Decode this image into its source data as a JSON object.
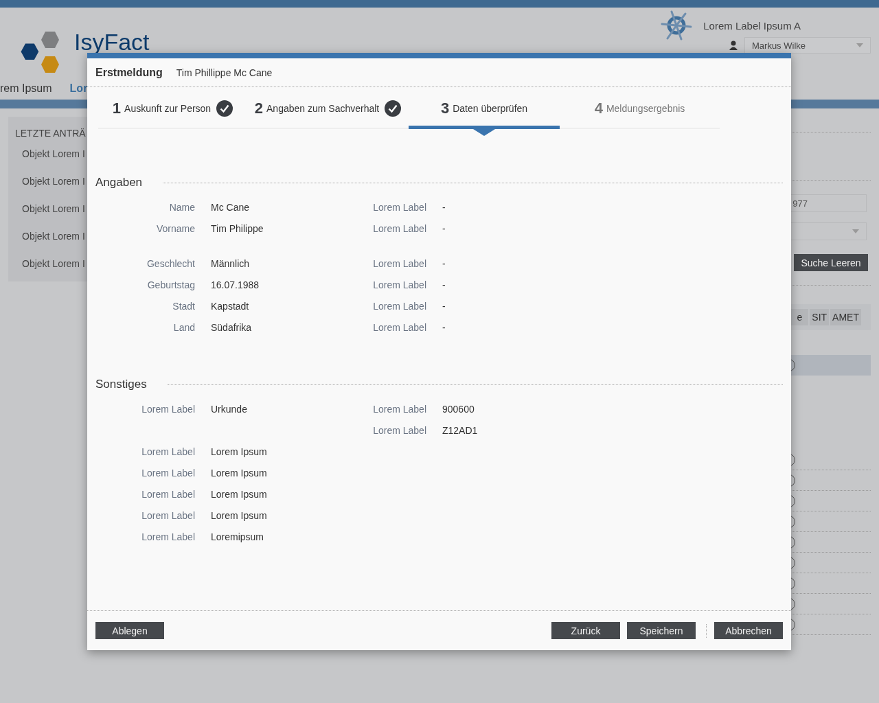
{
  "background": {
    "logo_text": "IsyFact",
    "app_label": "Lorem Label Ipsum A",
    "user": "Markus Wilke",
    "nav": [
      {
        "label": "rem Ipsum",
        "selected": false
      },
      {
        "label": "Lor",
        "selected": true
      }
    ],
    "sidebar": {
      "title": "LETZTE ANTRÄ",
      "items": [
        "Objekt Lorem I",
        "Objekt Lorem I",
        "Objekt Lorem I",
        "Objekt Lorem I",
        "Objekt Lorem I"
      ]
    },
    "search_field": {
      "value": "977"
    },
    "clear_button": "Suche Leeren",
    "table": {
      "columns": [
        "e",
        "SIT",
        "AMET"
      ],
      "rows": [
        {
          "selected": true
        },
        {
          "selected": false
        },
        {
          "selected": false
        },
        {
          "selected": false
        },
        {
          "selected": false
        },
        {
          "selected": false
        },
        {
          "selected": false
        },
        {
          "selected": false
        },
        {
          "selected": false
        },
        {
          "selected": false
        }
      ]
    }
  },
  "dialog": {
    "title": "Erstmeldung",
    "subtitle": "Tim Phillippe Mc Cane",
    "steps": [
      {
        "number": "1",
        "label": "Auskunft zur Person",
        "completed": true,
        "selected": false
      },
      {
        "number": "2",
        "label": "Angaben zum Sachverhalt",
        "completed": true,
        "selected": false
      },
      {
        "number": "3",
        "label": "Daten überprüfen",
        "completed": false,
        "selected": true
      },
      {
        "number": "4",
        "label": "Meldungsergebnis",
        "completed": false,
        "selected": false
      }
    ],
    "sections": [
      {
        "title": "Angaben",
        "groups": [
          [
            {
              "left": {
                "label": "Name",
                "value": "Mc Cane"
              },
              "right": {
                "label": "Lorem Label",
                "value": "-"
              }
            },
            {
              "left": {
                "label": "Vorname",
                "value": "Tim Philippe"
              },
              "right": {
                "label": "Lorem Label",
                "value": "-"
              }
            }
          ],
          [
            {
              "left": {
                "label": "Geschlecht",
                "value": "Männlich"
              },
              "right": {
                "label": "Lorem Label",
                "value": "-"
              }
            },
            {
              "left": {
                "label": "Geburtstag",
                "value": "16.07.1988"
              },
              "right": {
                "label": "Lorem Label",
                "value": "-"
              }
            },
            {
              "left": {
                "label": "Stadt",
                "value": "Kapstadt"
              },
              "right": {
                "label": "Lorem Label",
                "value": "-"
              }
            },
            {
              "left": {
                "label": "Land",
                "value": "Südafrika"
              },
              "right": {
                "label": "Lorem Label",
                "value": "-"
              }
            }
          ]
        ]
      },
      {
        "title": "Sonstiges",
        "groups": [
          [
            {
              "left": {
                "label": "Lorem Label",
                "value": "Urkunde"
              },
              "right": {
                "label": "Lorem Label",
                "value": "900600"
              }
            },
            {
              "right": {
                "label": "Lorem Label",
                "value": "Z12AD1"
              }
            },
            {
              "left": {
                "label": "Lorem Label",
                "value": "Lorem Ipsum"
              }
            },
            {
              "left": {
                "label": "Lorem Label",
                "value": "Lorem Ipsum"
              }
            },
            {
              "left": {
                "label": "Lorem Label",
                "value": "Lorem Ipsum"
              }
            },
            {
              "left": {
                "label": "Lorem Label",
                "value": "Lorem Ipsum"
              }
            },
            {
              "left": {
                "label": "Lorem Label",
                "value": "Loremipsum"
              }
            }
          ]
        ]
      }
    ],
    "footer": {
      "left_buttons": [
        "Ablegen"
      ],
      "right_buttons": [
        "Zurück",
        "Speichern"
      ],
      "end_buttons": [
        "Abbrechen"
      ]
    }
  }
}
